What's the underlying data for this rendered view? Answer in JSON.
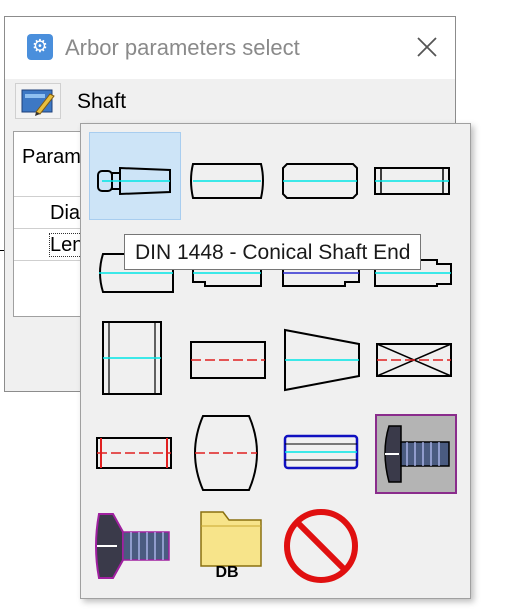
{
  "window": {
    "title": "Arbor parameters select",
    "app_icon_glyph": "⚙",
    "close_glyph": "close-icon"
  },
  "toolbar": {
    "shaft_label": "Shaft",
    "icon": "shaft-type-picker-icon"
  },
  "params": {
    "header": "Param",
    "rows": [
      "Dia",
      "Len"
    ]
  },
  "tooltip": {
    "text": "DIN 1448 - Conical Shaft End"
  },
  "shapes": [
    {
      "id": "conical-shaft-end",
      "icon": "conical-shaft-end-icon"
    },
    {
      "id": "shaft-rounded-both",
      "icon": "rounded-shaft-icon"
    },
    {
      "id": "shaft-chamfered",
      "icon": "chamfered-shaft-icon"
    },
    {
      "id": "shaft-groove-ends",
      "icon": "groove-shaft-icon"
    },
    {
      "id": "shaft-step-a",
      "icon": "stepped-shaft-icon"
    },
    {
      "id": "shaft-step-b",
      "icon": "stepped-shaft-icon"
    },
    {
      "id": "shaft-step-c",
      "icon": "stepped-shaft-icon"
    },
    {
      "id": "shaft-step-d",
      "icon": "stepped-shaft-icon"
    },
    {
      "id": "cylinder-tall",
      "icon": "tall-cylinder-icon"
    },
    {
      "id": "cylinder-red-axis",
      "icon": "cylinder-red-axis-icon"
    },
    {
      "id": "cone",
      "icon": "cone-icon"
    },
    {
      "id": "cross-section",
      "icon": "crossed-box-icon"
    },
    {
      "id": "cylinder-red-ends",
      "icon": "red-ends-cylinder-icon"
    },
    {
      "id": "rounded-barrel",
      "icon": "barrel-icon"
    },
    {
      "id": "cylinder-blue",
      "icon": "blue-cylinder-icon"
    },
    {
      "id": "screw-hex",
      "icon": "screw-icon"
    },
    {
      "id": "screw-countersunk",
      "icon": "countersunk-screw-icon"
    },
    {
      "id": "database-folder",
      "icon": "folder-db-icon",
      "label": "DB"
    },
    {
      "id": "none",
      "icon": "no-sign-icon"
    }
  ],
  "colors": {
    "hover": "#cde4f7",
    "axis_cyan": "#00e5e5",
    "axis_red": "#e02020",
    "outline_blue": "#1010c0",
    "no_sign_red": "#e01010",
    "folder_yellow": "#f7e48a"
  }
}
